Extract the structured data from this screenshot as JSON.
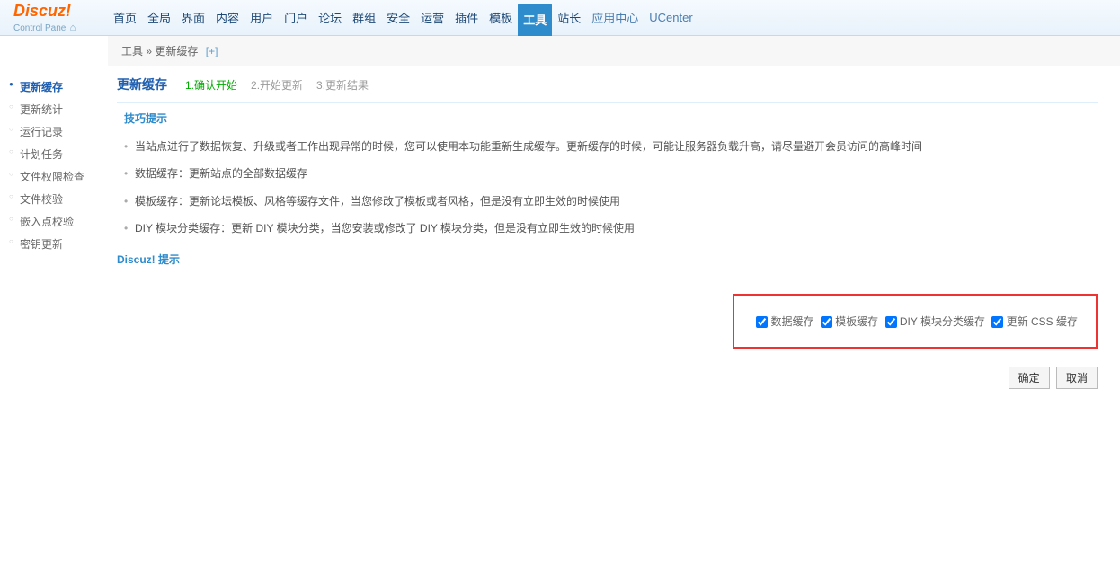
{
  "logo": {
    "main": "Discuz!",
    "sub": "Control Panel"
  },
  "topnav": [
    {
      "label": "首页"
    },
    {
      "label": "全局"
    },
    {
      "label": "界面"
    },
    {
      "label": "内容"
    },
    {
      "label": "用户"
    },
    {
      "label": "门户"
    },
    {
      "label": "论坛"
    },
    {
      "label": "群组"
    },
    {
      "label": "安全"
    },
    {
      "label": "运营"
    },
    {
      "label": "插件"
    },
    {
      "label": "模板"
    },
    {
      "label": "工具",
      "active": true
    },
    {
      "label": "站长"
    },
    {
      "label": "应用中心",
      "cls": "app-center"
    },
    {
      "label": "UCenter",
      "cls": "ucenter"
    }
  ],
  "breadcrumb": {
    "section": "工具",
    "sep": "»",
    "page": "更新缓存",
    "plus": "[+]"
  },
  "sidebar": [
    {
      "label": "更新缓存",
      "active": true
    },
    {
      "label": "更新统计"
    },
    {
      "label": "运行记录"
    },
    {
      "label": "计划任务"
    },
    {
      "label": "文件权限检查"
    },
    {
      "label": "文件校验"
    },
    {
      "label": "嵌入点校验"
    },
    {
      "label": "密钥更新"
    }
  ],
  "page": {
    "title": "更新缓存"
  },
  "steps": [
    {
      "label": "1.确认开始",
      "active": true
    },
    {
      "label": "2.开始更新"
    },
    {
      "label": "3.更新结果"
    }
  ],
  "tips": {
    "title": "技巧提示",
    "items": [
      "当站点进行了数据恢复、升级或者工作出现异常的时候，您可以使用本功能重新生成缓存。更新缓存的时候，可能让服务器负载升高，请尽量避开会员访问的高峰时间",
      "数据缓存：更新站点的全部数据缓存",
      "模板缓存：更新论坛模板、风格等缓存文件，当您修改了模板或者风格，但是没有立即生效的时候使用",
      "DIY 模块分类缓存：更新 DIY 模块分类，当您安装或修改了 DIY 模块分类，但是没有立即生效的时候使用"
    ]
  },
  "prompt": {
    "title": "Discuz! 提示"
  },
  "checkboxes": [
    {
      "label": "数据缓存"
    },
    {
      "label": "模板缓存"
    },
    {
      "label": "DIY 模块分类缓存"
    },
    {
      "label": "更新 CSS 缓存"
    }
  ],
  "buttons": {
    "ok": "确定",
    "cancel": "取消"
  }
}
